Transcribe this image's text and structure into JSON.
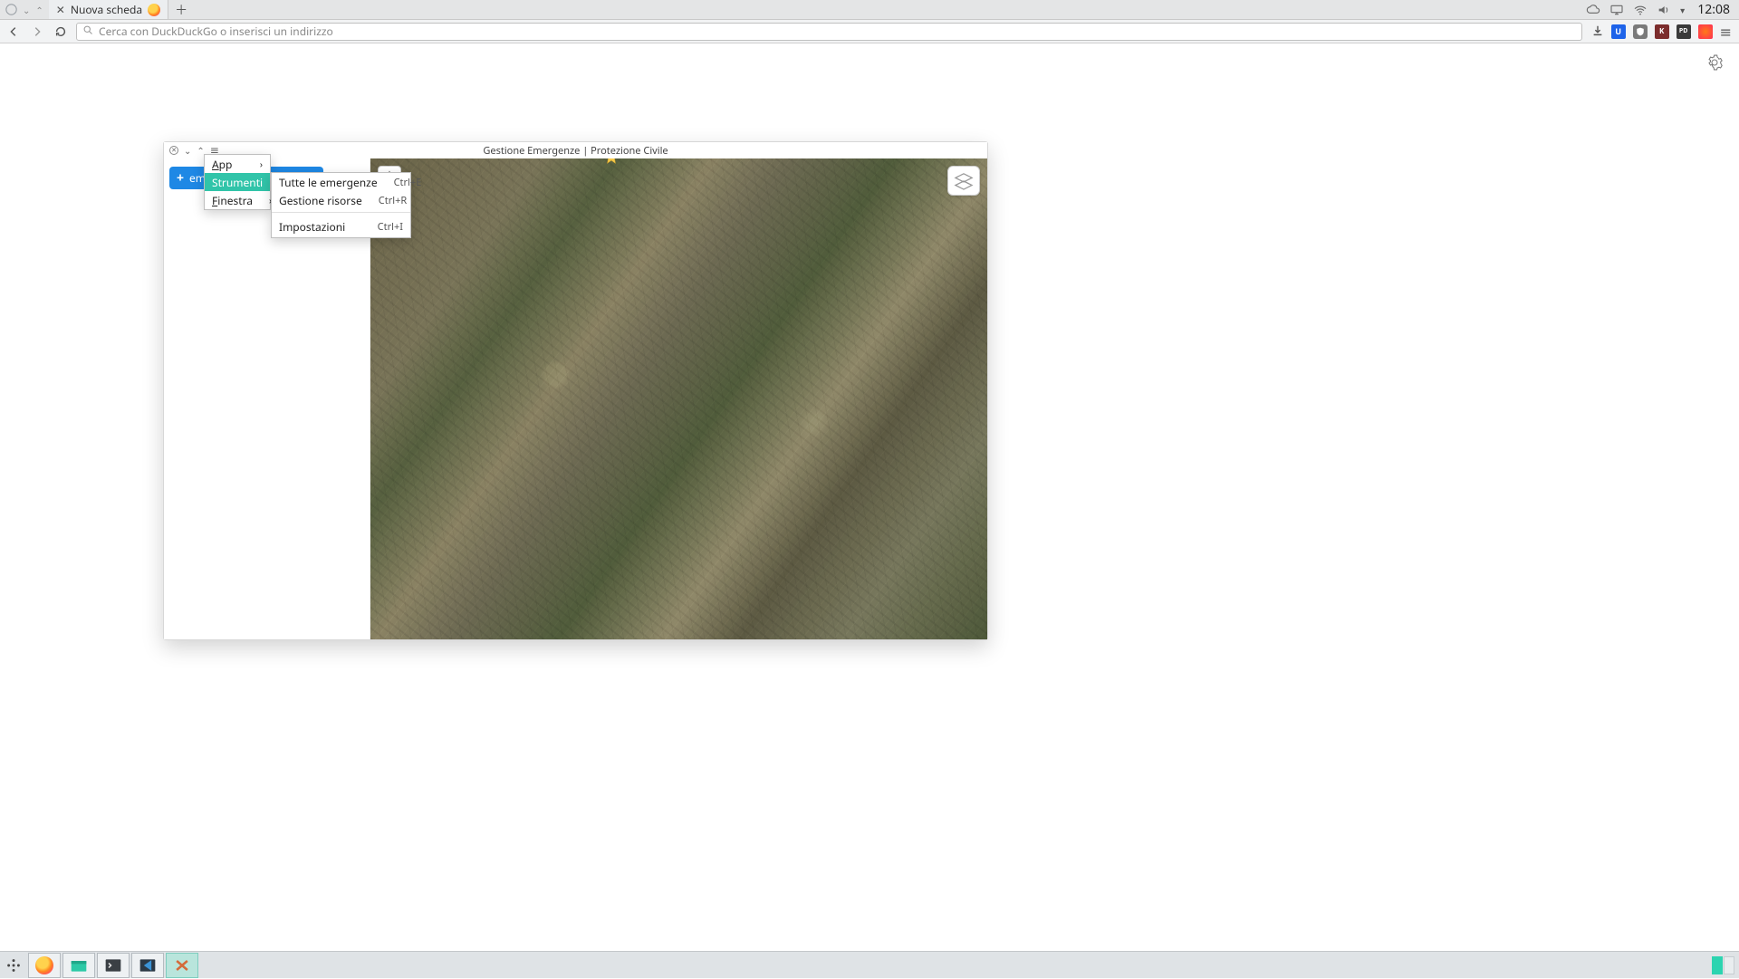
{
  "desktop": {
    "tab_label": "Nuova scheda",
    "clock": "12:08"
  },
  "browser": {
    "url_placeholder": "Cerca con DuckDuckGo o inserisci un indirizzo",
    "ext_labels": {
      "bw": "",
      "u": "U",
      "shield": "",
      "k": "K",
      "pd": "PD",
      "o": ""
    }
  },
  "app": {
    "title": "Gestione Emergenze | Protezione Civile",
    "add_button": "em",
    "menu1": {
      "items": [
        {
          "label": "App"
        },
        {
          "label": "Strumenti"
        },
        {
          "label": "Finestra"
        }
      ]
    },
    "menu2": {
      "items": [
        {
          "label": "Tutte le emergenze",
          "shortcut": "Ctrl+E"
        },
        {
          "label": "Gestione risorse",
          "shortcut": "Ctrl+R"
        },
        {
          "label": "Impostazioni",
          "shortcut": "Ctrl+I"
        }
      ]
    }
  }
}
